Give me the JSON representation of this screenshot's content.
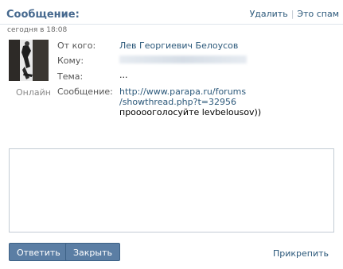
{
  "header": {
    "title": "Сообщение:",
    "actions": {
      "delete": "Удалить",
      "spam": "Это спам"
    }
  },
  "message": {
    "timestamp": "сегодня в 18:08",
    "sender_status": "Онлайн",
    "from_label": "От кого:",
    "from_value": "Лев Георгиевич Белоусов",
    "to_label": "Кому:",
    "subject_label": "Тема:",
    "subject_value": "...",
    "body_label": "Сообщение:",
    "link_line1": "http://www.parapa.ru/forums",
    "link_line2": "/showthread.php?t=32956",
    "text_after": " прооооголосуйте levbelousov))"
  },
  "reply": {
    "value": "",
    "placeholder": ""
  },
  "buttons": {
    "reply": "Ответить",
    "close": "Закрыть",
    "attach": "Прикрепить"
  },
  "colors": {
    "accent": "#45688e",
    "link": "#2b587a",
    "button_bg": "#5b7ea4"
  }
}
